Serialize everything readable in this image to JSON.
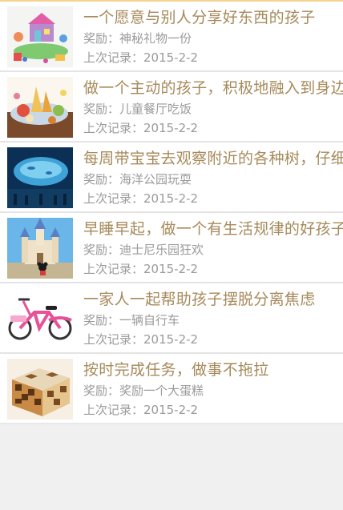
{
  "tasks": [
    {
      "title": "一个愿意与别人分享好东西的孩子",
      "reward": "奖励：神秘礼物一份",
      "record": "上次记录：2015-2-2",
      "image": "toy-playset-image"
    },
    {
      "title": "做一个主动的孩子，积极地融入到身边",
      "reward": "奖励：儿童餐厅吃饭",
      "record": "上次记录：2015-2-2",
      "image": "restaurant-meal-image"
    },
    {
      "title": "每周带宝宝去观察附近的各种树，仔细",
      "reward": "奖励：海洋公园玩耍",
      "record": "上次记录：2015-2-2",
      "image": "ocean-park-aquarium-image"
    },
    {
      "title": "早睡早起，做一个有生活规律的好孩子",
      "reward": "奖励：迪士尼乐园狂欢",
      "record": "上次记录：2015-2-2",
      "image": "disney-castle-image"
    },
    {
      "title": "一家人一起帮助孩子摆脱分离焦虑",
      "reward": "奖励：一辆自行车",
      "record": "上次记录：2015-2-2",
      "image": "pink-bicycle-image"
    },
    {
      "title": "按时完成任务，做事不拖拉",
      "reward": "奖励：奖励一个大蛋糕",
      "record": "上次记录：2015-2-2",
      "image": "checkered-cake-image"
    }
  ]
}
